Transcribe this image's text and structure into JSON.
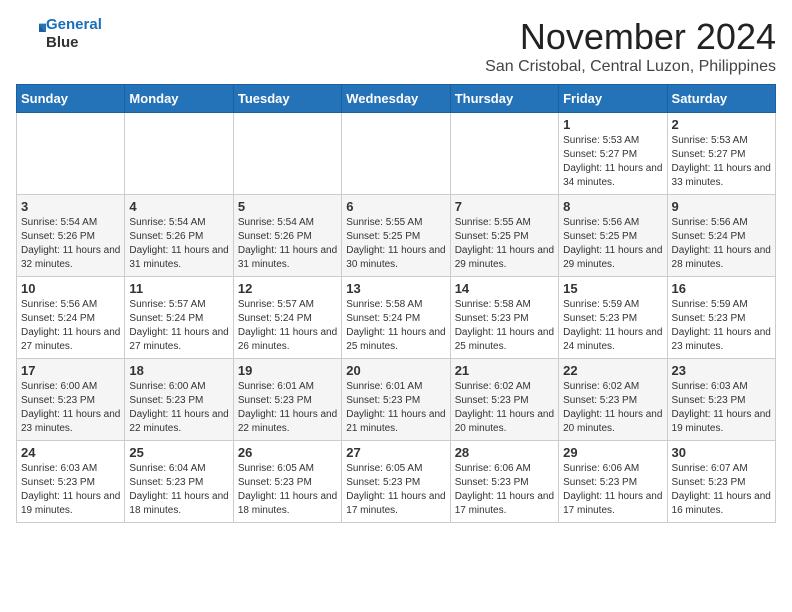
{
  "header": {
    "logo_line1": "General",
    "logo_line2": "Blue",
    "month": "November 2024",
    "location": "San Cristobal, Central Luzon, Philippines"
  },
  "weekdays": [
    "Sunday",
    "Monday",
    "Tuesday",
    "Wednesday",
    "Thursday",
    "Friday",
    "Saturday"
  ],
  "weeks": [
    [
      {
        "day": "",
        "info": ""
      },
      {
        "day": "",
        "info": ""
      },
      {
        "day": "",
        "info": ""
      },
      {
        "day": "",
        "info": ""
      },
      {
        "day": "",
        "info": ""
      },
      {
        "day": "1",
        "info": "Sunrise: 5:53 AM\nSunset: 5:27 PM\nDaylight: 11 hours and 34 minutes."
      },
      {
        "day": "2",
        "info": "Sunrise: 5:53 AM\nSunset: 5:27 PM\nDaylight: 11 hours and 33 minutes."
      }
    ],
    [
      {
        "day": "3",
        "info": "Sunrise: 5:54 AM\nSunset: 5:26 PM\nDaylight: 11 hours and 32 minutes."
      },
      {
        "day": "4",
        "info": "Sunrise: 5:54 AM\nSunset: 5:26 PM\nDaylight: 11 hours and 31 minutes."
      },
      {
        "day": "5",
        "info": "Sunrise: 5:54 AM\nSunset: 5:26 PM\nDaylight: 11 hours and 31 minutes."
      },
      {
        "day": "6",
        "info": "Sunrise: 5:55 AM\nSunset: 5:25 PM\nDaylight: 11 hours and 30 minutes."
      },
      {
        "day": "7",
        "info": "Sunrise: 5:55 AM\nSunset: 5:25 PM\nDaylight: 11 hours and 29 minutes."
      },
      {
        "day": "8",
        "info": "Sunrise: 5:56 AM\nSunset: 5:25 PM\nDaylight: 11 hours and 29 minutes."
      },
      {
        "day": "9",
        "info": "Sunrise: 5:56 AM\nSunset: 5:24 PM\nDaylight: 11 hours and 28 minutes."
      }
    ],
    [
      {
        "day": "10",
        "info": "Sunrise: 5:56 AM\nSunset: 5:24 PM\nDaylight: 11 hours and 27 minutes."
      },
      {
        "day": "11",
        "info": "Sunrise: 5:57 AM\nSunset: 5:24 PM\nDaylight: 11 hours and 27 minutes."
      },
      {
        "day": "12",
        "info": "Sunrise: 5:57 AM\nSunset: 5:24 PM\nDaylight: 11 hours and 26 minutes."
      },
      {
        "day": "13",
        "info": "Sunrise: 5:58 AM\nSunset: 5:24 PM\nDaylight: 11 hours and 25 minutes."
      },
      {
        "day": "14",
        "info": "Sunrise: 5:58 AM\nSunset: 5:23 PM\nDaylight: 11 hours and 25 minutes."
      },
      {
        "day": "15",
        "info": "Sunrise: 5:59 AM\nSunset: 5:23 PM\nDaylight: 11 hours and 24 minutes."
      },
      {
        "day": "16",
        "info": "Sunrise: 5:59 AM\nSunset: 5:23 PM\nDaylight: 11 hours and 23 minutes."
      }
    ],
    [
      {
        "day": "17",
        "info": "Sunrise: 6:00 AM\nSunset: 5:23 PM\nDaylight: 11 hours and 23 minutes."
      },
      {
        "day": "18",
        "info": "Sunrise: 6:00 AM\nSunset: 5:23 PM\nDaylight: 11 hours and 22 minutes."
      },
      {
        "day": "19",
        "info": "Sunrise: 6:01 AM\nSunset: 5:23 PM\nDaylight: 11 hours and 22 minutes."
      },
      {
        "day": "20",
        "info": "Sunrise: 6:01 AM\nSunset: 5:23 PM\nDaylight: 11 hours and 21 minutes."
      },
      {
        "day": "21",
        "info": "Sunrise: 6:02 AM\nSunset: 5:23 PM\nDaylight: 11 hours and 20 minutes."
      },
      {
        "day": "22",
        "info": "Sunrise: 6:02 AM\nSunset: 5:23 PM\nDaylight: 11 hours and 20 minutes."
      },
      {
        "day": "23",
        "info": "Sunrise: 6:03 AM\nSunset: 5:23 PM\nDaylight: 11 hours and 19 minutes."
      }
    ],
    [
      {
        "day": "24",
        "info": "Sunrise: 6:03 AM\nSunset: 5:23 PM\nDaylight: 11 hours and 19 minutes."
      },
      {
        "day": "25",
        "info": "Sunrise: 6:04 AM\nSunset: 5:23 PM\nDaylight: 11 hours and 18 minutes."
      },
      {
        "day": "26",
        "info": "Sunrise: 6:05 AM\nSunset: 5:23 PM\nDaylight: 11 hours and 18 minutes."
      },
      {
        "day": "27",
        "info": "Sunrise: 6:05 AM\nSunset: 5:23 PM\nDaylight: 11 hours and 17 minutes."
      },
      {
        "day": "28",
        "info": "Sunrise: 6:06 AM\nSunset: 5:23 PM\nDaylight: 11 hours and 17 minutes."
      },
      {
        "day": "29",
        "info": "Sunrise: 6:06 AM\nSunset: 5:23 PM\nDaylight: 11 hours and 17 minutes."
      },
      {
        "day": "30",
        "info": "Sunrise: 6:07 AM\nSunset: 5:23 PM\nDaylight: 11 hours and 16 minutes."
      }
    ]
  ]
}
